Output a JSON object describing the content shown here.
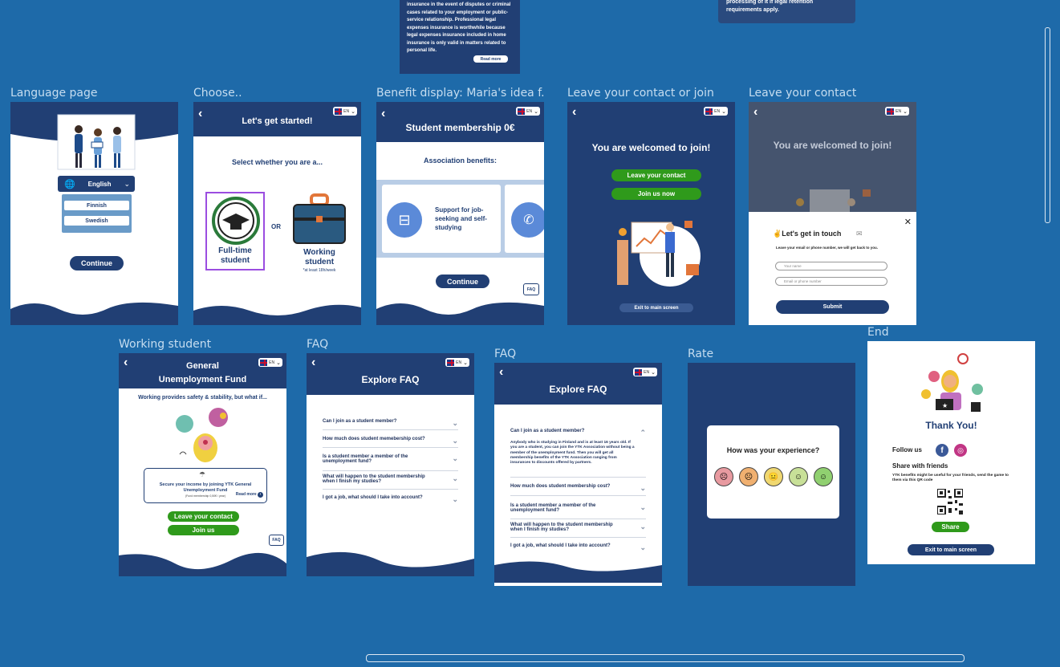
{
  "top_card_left": {
    "text": "insurance in the event of disputes or criminal cases related to your employment or public-service relationship. Professional legal expenses insurance is worthwhile because legal expenses insurance included in home insurance is only valid in matters related to personal life.",
    "button": "Read more"
  },
  "top_card_right": {
    "text": "processing of it if legal retention requirements apply."
  },
  "frames": {
    "language": {
      "label": "Language page",
      "selected_language": "English",
      "options": [
        "Finnish",
        "Swedish"
      ],
      "continue": "Continue"
    },
    "choose": {
      "label": "Choose..",
      "title": "Let's get started!",
      "subtitle": "Select whether you are a...",
      "option1_line1": "Full-time",
      "option1_line2": "student",
      "or": "OR",
      "option2_line1": "Working",
      "option2_line2": "student",
      "option2_note": "*at least 18h/week"
    },
    "benefit": {
      "label": "Benefit display: Maria's idea f...",
      "title": "Student membership 0€",
      "section": "Association benefits:",
      "card_text": "Support for job-seeking and self-studying",
      "continue": "Continue",
      "faq": "FAQ"
    },
    "contact_or_join": {
      "label": "Leave your contact or join",
      "title": "You are welcomed to join!",
      "btn1": "Leave your contact",
      "btn2": "Join us now",
      "exit": "Exit to main screen"
    },
    "contact": {
      "label": "Leave your contact",
      "title": "You are welcomed to join!",
      "modal_title": "Let's get in touch",
      "modal_sub": "Leave your email or phone number, we will get back to you.",
      "name_ph": "Your name",
      "contact_ph": "Email or phone number",
      "submit": "Submit"
    },
    "working": {
      "label": "Working student",
      "title_line1": "General",
      "title_line2": "Unemployment Fund",
      "subtitle": "Working provides safety & stability, but what if...",
      "card_text": "Secure your income by joining YTK General Unemployment Fund",
      "card_note": "(Fund membership 0,50€ / year)",
      "read_more": "Read more",
      "btn1": "Leave your contact",
      "btn2": "Join us",
      "faq": "FAQ"
    },
    "faq1": {
      "label": "FAQ",
      "title": "Explore FAQ",
      "questions": [
        "Can I join as a student member?",
        "How much does student memebership cost?",
        "Is a student member a member of the unemployment fund?",
        "What will happen to the student membership when I finish my studies?",
        "I got  a job, what should I take into account?"
      ]
    },
    "faq2": {
      "label": "FAQ",
      "title": "Explore FAQ",
      "q1": "Can I join as a student member?",
      "answer": "Anybody who is studying in Finland and is at least 16 years old. If you are a student, you can join the YTK Association without being a member of the unemployment fund. Then you will get all membership benefits of the YTK Association ranging from insurances to discounts offered by partners.",
      "questions": [
        "How much does student membership cost?",
        "Is a student member a member of the unemployment fund?",
        "What will happen to the student membership when I finish my studies?",
        "I got  a job, what should I take into account?"
      ]
    },
    "rate": {
      "label": "Rate",
      "question": "How was your experience?"
    },
    "end": {
      "label": "End",
      "title": "Thank You!",
      "follow": "Follow us",
      "share_title": "Share with friends",
      "share_text": "YTK benefits might be useful for your friends, send the game to them via this QR code",
      "share_btn": "Share",
      "exit": "Exit to main screen"
    }
  },
  "colors": {
    "canvas": "#1e6aa9",
    "navy": "#213f74",
    "green": "#2f9a1b",
    "accent_purple": "#9b4de0"
  }
}
